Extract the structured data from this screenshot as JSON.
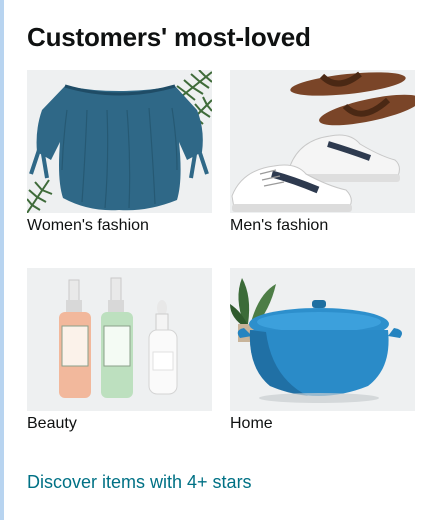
{
  "section": {
    "title": "Customers' most-loved",
    "tiles": [
      {
        "label": "Women's fashion",
        "icon": "blouse-image"
      },
      {
        "label": "Men's fashion",
        "icon": "sneakers-sandals-image"
      },
      {
        "label": "Beauty",
        "icon": "beauty-bottles-image"
      },
      {
        "label": "Home",
        "icon": "dutch-oven-image"
      }
    ],
    "discover_link": "Discover items with 4+ stars"
  },
  "colors": {
    "link": "#007185",
    "text": "#0f1111",
    "tile_bg": "#eef0f1",
    "edge": "#b8d4f0"
  }
}
